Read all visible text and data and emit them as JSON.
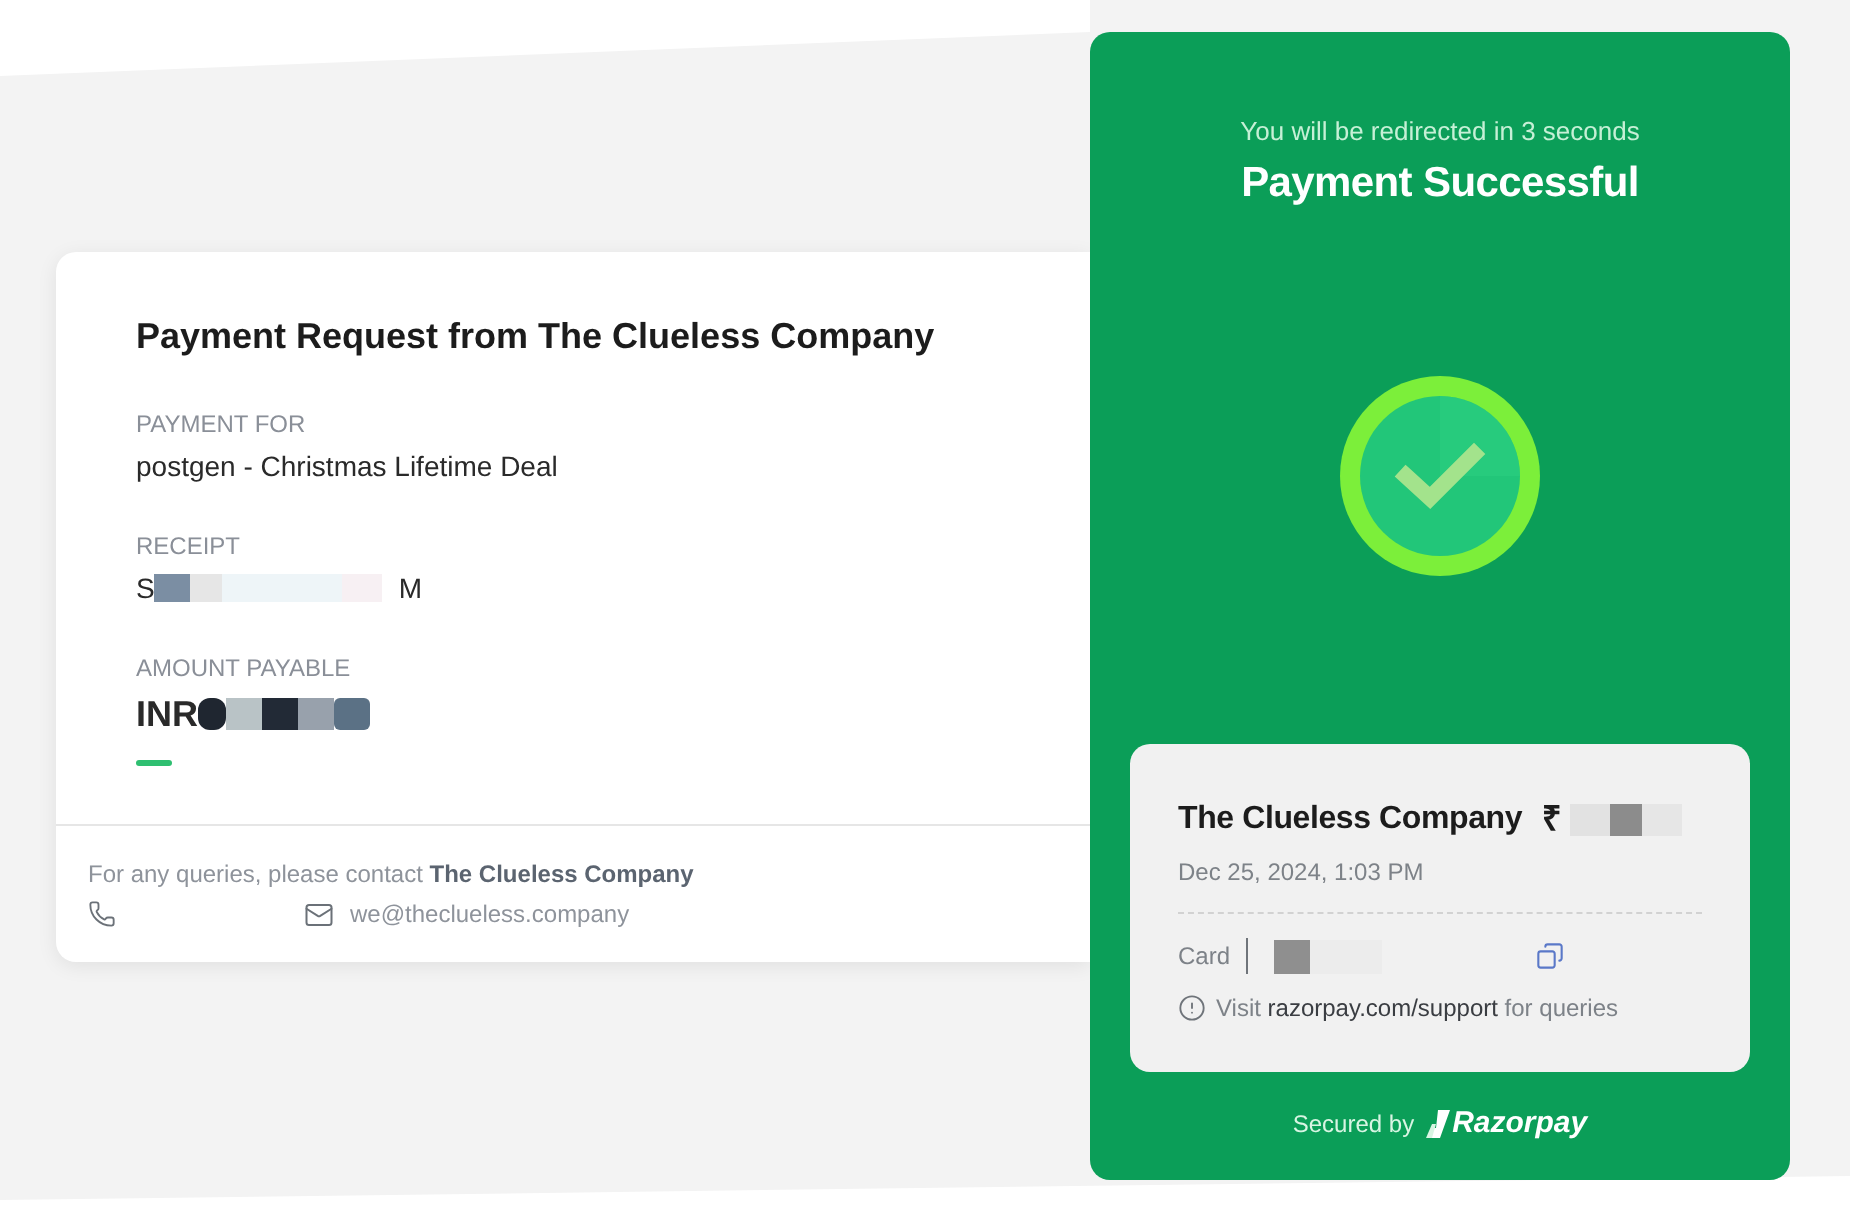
{
  "request": {
    "title": "Payment Request from The Clueless Company",
    "fields": [
      {
        "kind": "text",
        "label": "PAYMENT FOR",
        "value": "postgen - Christmas Lifetime Deal"
      },
      {
        "kind": "masked",
        "label": "RECEIPT",
        "prefix": "S",
        "suffix": "M"
      },
      {
        "kind": "amount",
        "label": "AMOUNT PAYABLE",
        "currency": "INR"
      }
    ]
  },
  "footer": {
    "note": "For any queries, please contact **The Clueless Company**",
    "email": "we@theclueless.company"
  },
  "success_panel": {
    "redirect_notice": "You will be redirected in 3 seconds",
    "title": "Payment Successful",
    "receipt_card": {
      "merchant": "The Clueless Company",
      "currency_symbol": "₹",
      "date": "Dec 25, 2024, 1:03 PM",
      "method_label": "Card",
      "support_note": "Visit **razorpay.com/support** for queries"
    },
    "secured_by": "Secured by",
    "brand": "Razorpay"
  }
}
